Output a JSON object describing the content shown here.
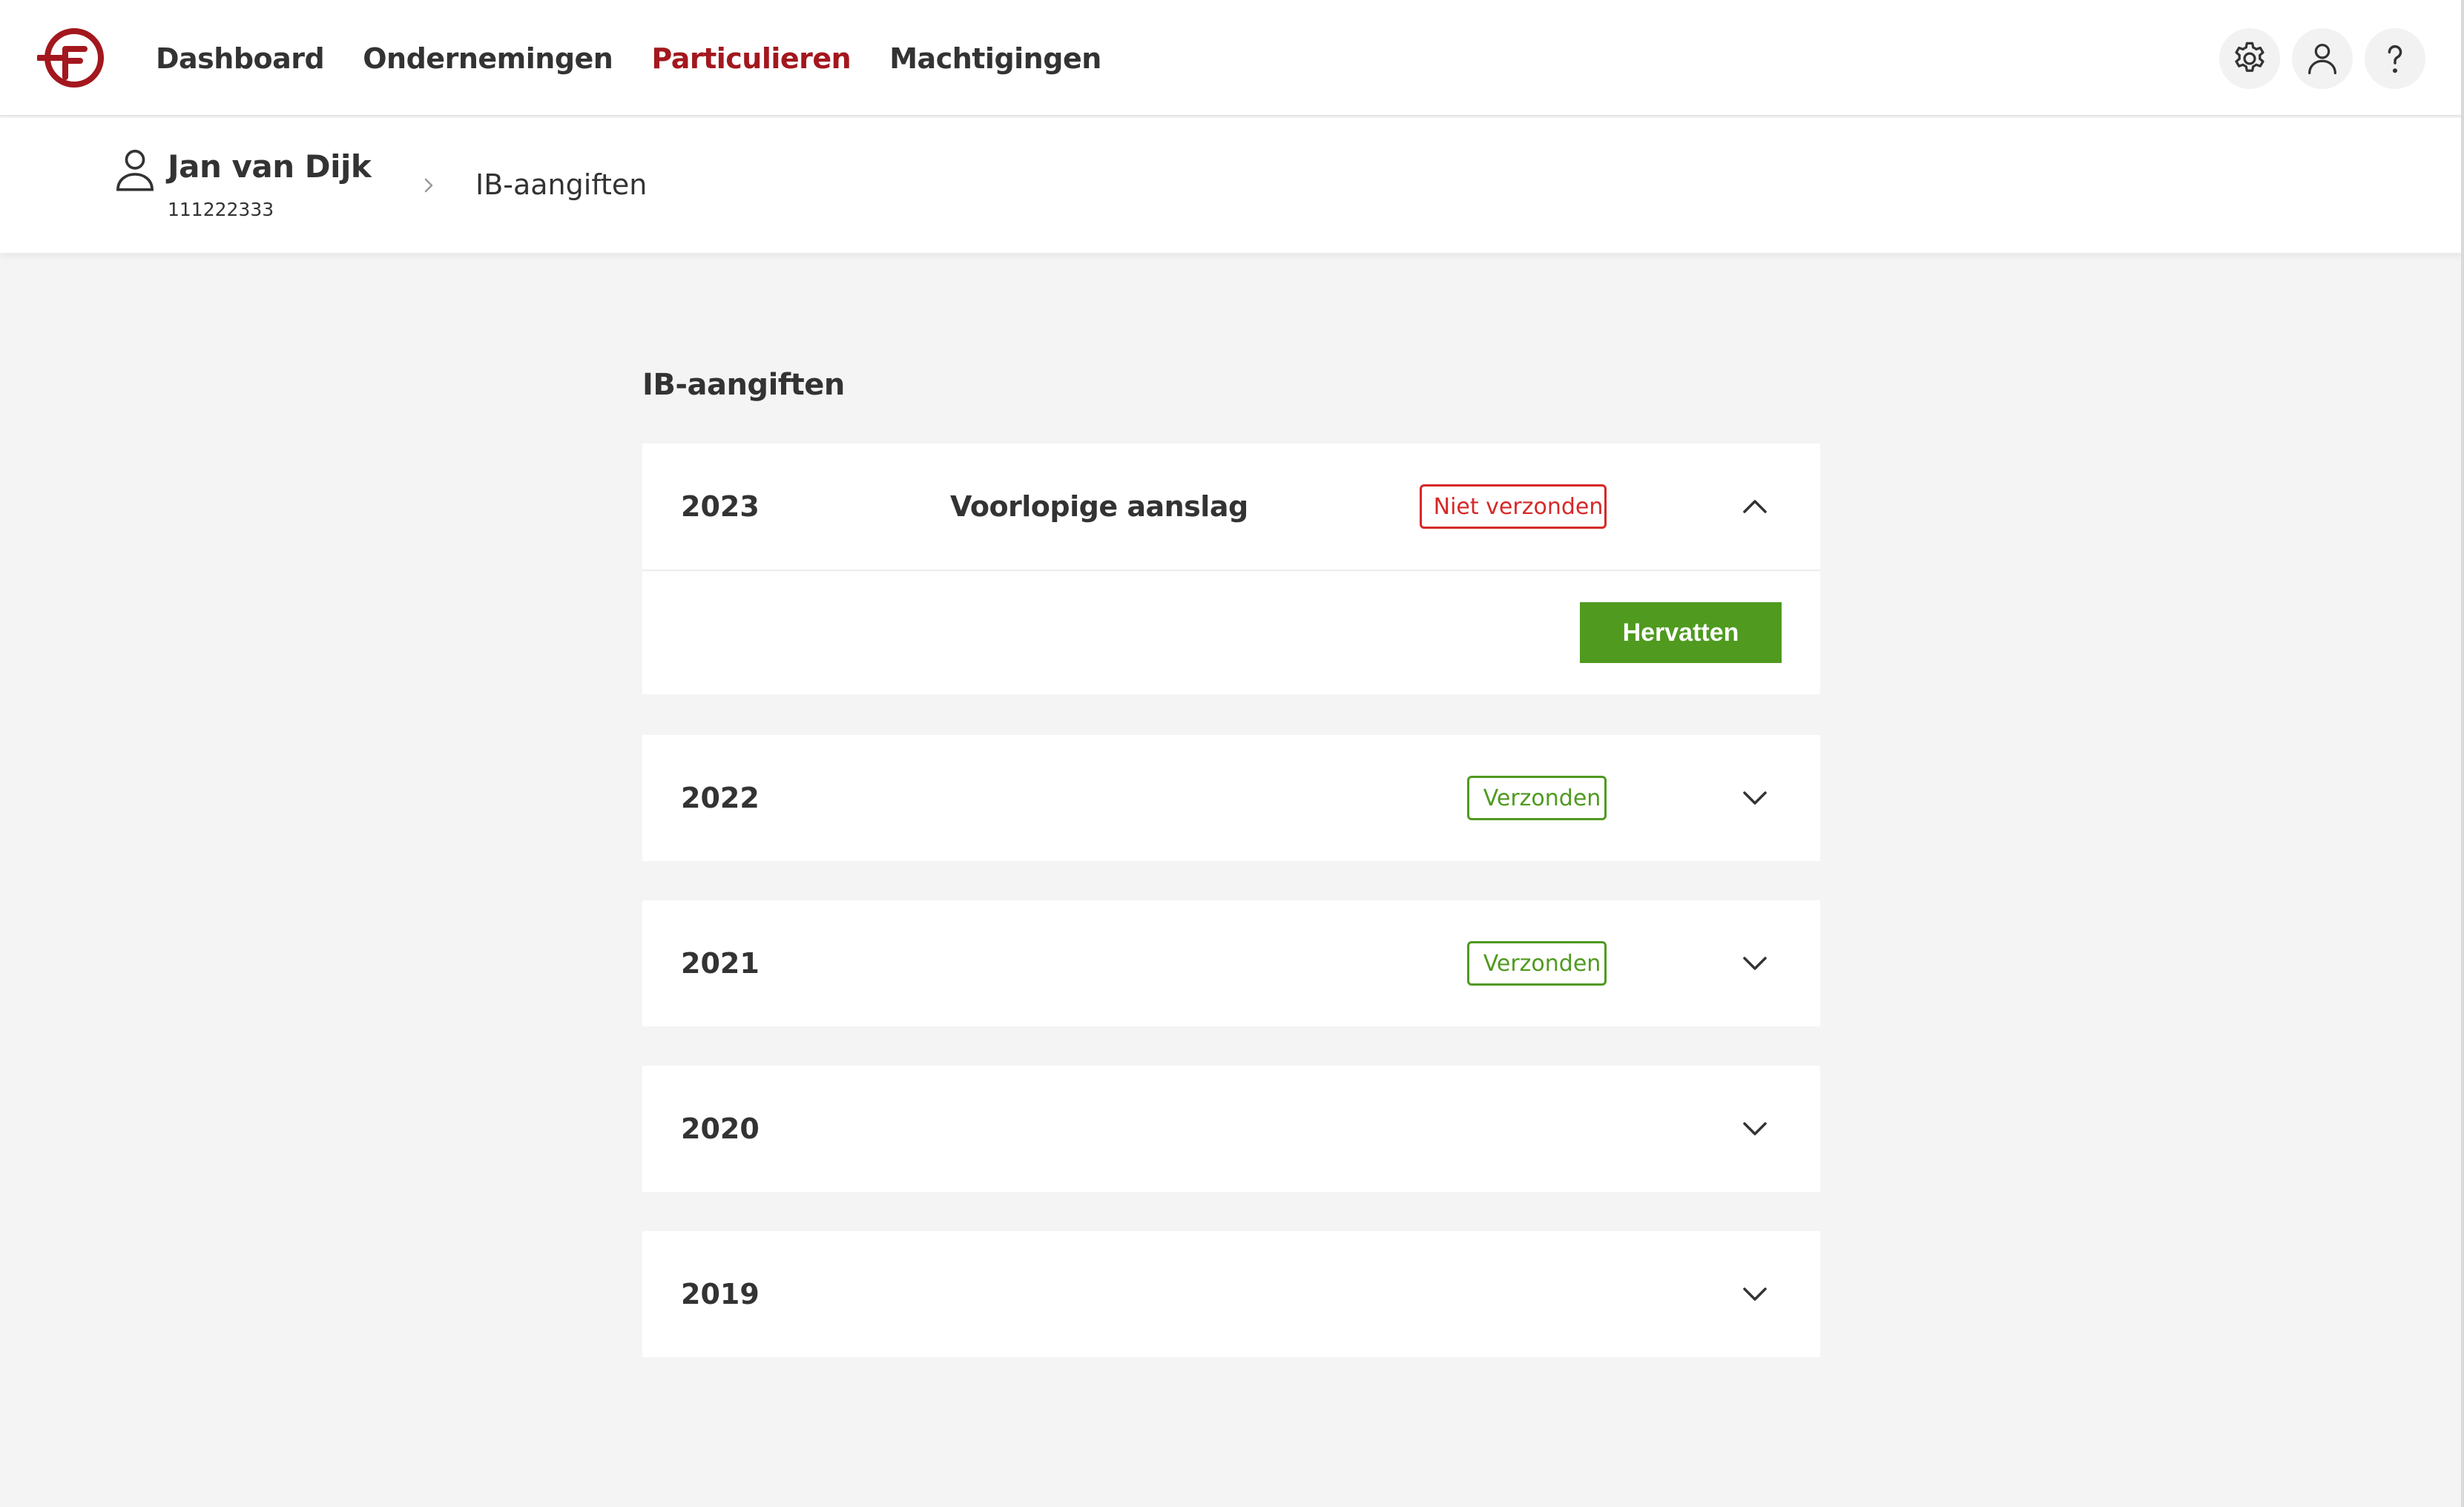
{
  "brand": {
    "accent": "#a3171e",
    "green": "#4f9a1f",
    "red": "#d62828"
  },
  "nav": {
    "items": [
      {
        "label": "Dashboard",
        "active": false
      },
      {
        "label": "Ondernemingen",
        "active": false
      },
      {
        "label": "Particulieren",
        "active": true
      },
      {
        "label": "Machtigingen",
        "active": false
      }
    ]
  },
  "header_icons": [
    "gear-icon",
    "user-icon",
    "help-icon"
  ],
  "person": {
    "name": "Jan van Dijk",
    "id": "111222333",
    "icon": "user-icon"
  },
  "breadcrumb": {
    "current": "IB-aangiften"
  },
  "page": {
    "title": "IB-aangiften"
  },
  "returns": [
    {
      "year": "2023",
      "title": "Voorlopige aanslag",
      "status": "Niet verzonden",
      "status_type": "error",
      "expanded": true,
      "action_label": "Hervatten"
    },
    {
      "year": "2022",
      "title": "",
      "status": "Verzonden",
      "status_type": "sent",
      "expanded": false
    },
    {
      "year": "2021",
      "title": "",
      "status": "Verzonden",
      "status_type": "sent",
      "expanded": false
    },
    {
      "year": "2020",
      "title": "",
      "status": "",
      "status_type": "none",
      "expanded": false
    },
    {
      "year": "2019",
      "title": "",
      "status": "",
      "status_type": "none",
      "expanded": false
    }
  ]
}
